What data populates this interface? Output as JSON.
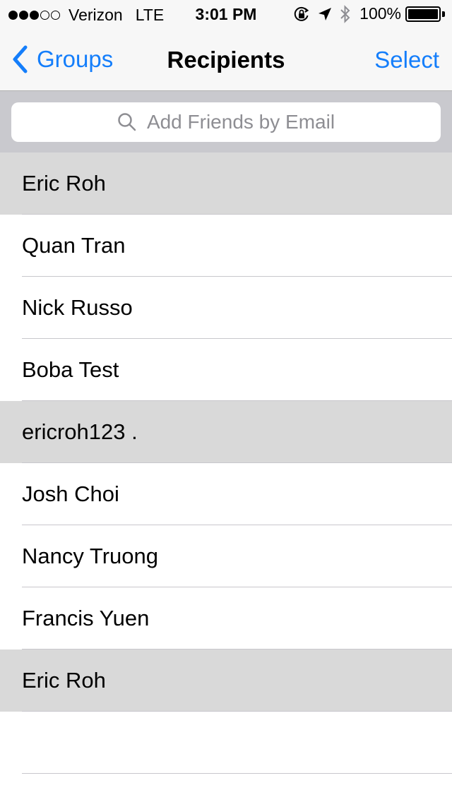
{
  "status_bar": {
    "carrier": "Verizon",
    "network": "LTE",
    "time": "3:01 PM",
    "battery_percent": "100%",
    "signal_bars_filled": 3,
    "signal_bars_total": 5,
    "battery_level": 1.0
  },
  "nav": {
    "back_label": "Groups",
    "title": "Recipients",
    "select_label": "Select"
  },
  "search": {
    "placeholder": "Add Friends by Email"
  },
  "contacts": [
    {
      "name": "Eric Roh",
      "selected": true
    },
    {
      "name": "Quan Tran",
      "selected": false
    },
    {
      "name": "Nick Russo",
      "selected": false
    },
    {
      "name": "Boba Test",
      "selected": false
    },
    {
      "name": "ericroh123 .",
      "selected": true
    },
    {
      "name": "Josh Choi",
      "selected": false
    },
    {
      "name": "Nancy Truong",
      "selected": false
    },
    {
      "name": "Francis Yuen",
      "selected": false
    },
    {
      "name": "Eric Roh",
      "selected": true
    }
  ],
  "colors": {
    "accent": "#147efb",
    "selected_row": "#d9d9d9",
    "bar_background": "#f7f7f7",
    "search_background": "#c9c9ce",
    "placeholder": "#8e8e93",
    "separator": "#c8c7cc"
  },
  "icons": {
    "back": "chevron-left-icon",
    "search": "search-icon",
    "orientation_lock": "orientation-lock-icon",
    "location": "location-arrow-icon",
    "bluetooth": "bluetooth-icon",
    "battery": "battery-icon"
  }
}
